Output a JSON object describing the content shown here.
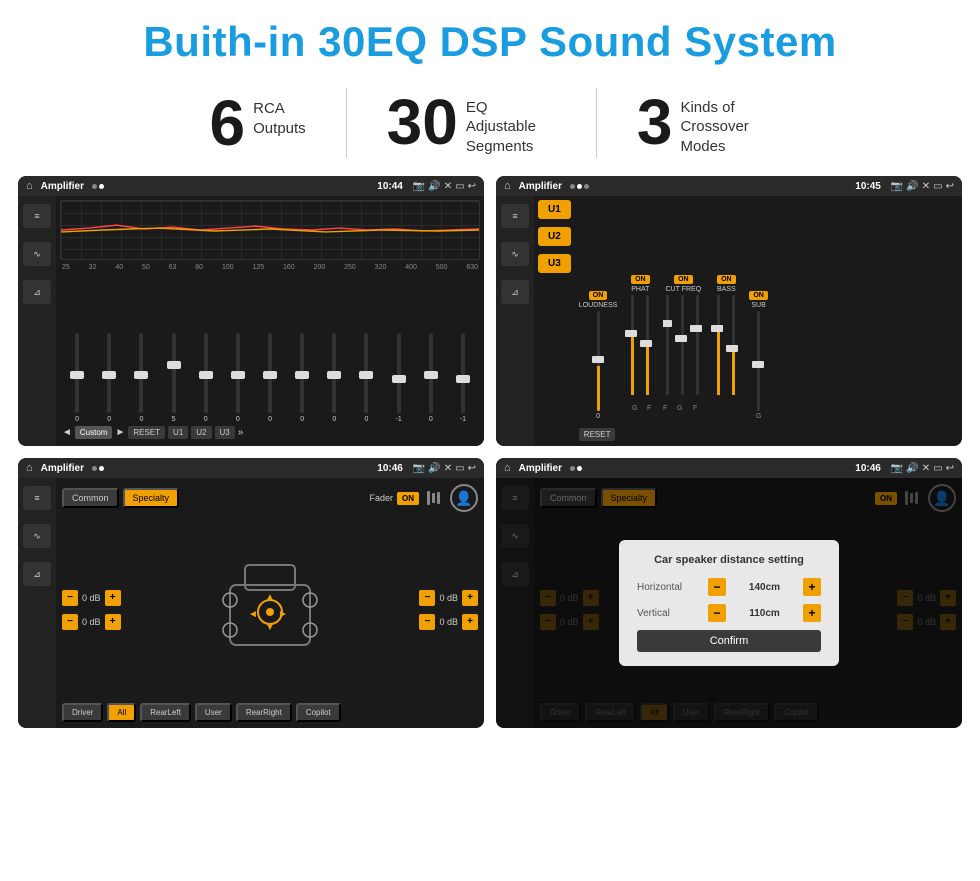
{
  "page": {
    "title": "Buith-in 30EQ DSP Sound System",
    "stats": [
      {
        "number": "6",
        "label": "RCA\nOutputs"
      },
      {
        "number": "30",
        "label": "EQ Adjustable\nSegments"
      },
      {
        "number": "3",
        "label": "Kinds of\nCrossover Modes"
      }
    ]
  },
  "screen1": {
    "appName": "Amplifier",
    "time": "10:44",
    "freqLabels": [
      "25",
      "32",
      "40",
      "50",
      "63",
      "80",
      "100",
      "125",
      "160",
      "200",
      "250",
      "320",
      "400",
      "500",
      "630"
    ],
    "sliderValues": [
      "0",
      "0",
      "0",
      "5",
      "0",
      "0",
      "0",
      "0",
      "0",
      "0",
      "-1",
      "0",
      "-1"
    ],
    "buttons": [
      "◄",
      "Custom",
      "►",
      "RESET",
      "U1",
      "U2",
      "U3"
    ]
  },
  "screen2": {
    "appName": "Amplifier",
    "time": "10:45",
    "uButtons": [
      "U1",
      "U2",
      "U3"
    ],
    "columns": [
      {
        "label": "LOUDNESS",
        "on": true
      },
      {
        "label": "PHAT",
        "on": true
      },
      {
        "label": "CUT FREQ",
        "on": true
      },
      {
        "label": "BASS",
        "on": true
      },
      {
        "label": "SUB",
        "on": true
      }
    ],
    "resetBtn": "RESET"
  },
  "screen3": {
    "appName": "Amplifier",
    "time": "10:46",
    "tabs": [
      "Common",
      "Specialty"
    ],
    "faderLabel": "Fader",
    "onToggle": "ON",
    "dbValues": [
      "0 dB",
      "0 dB",
      "0 dB",
      "0 dB"
    ],
    "bottomBtns": [
      "Driver",
      "RearLeft",
      "All",
      "User",
      "RearRight",
      "Copilot"
    ]
  },
  "screen4": {
    "appName": "Amplifier",
    "time": "10:46",
    "tabs": [
      "Common",
      "Specialty"
    ],
    "onToggle": "ON",
    "dialog": {
      "title": "Car speaker distance setting",
      "horizontal": "140cm",
      "vertical": "110cm",
      "horizontalLabel": "Horizontal",
      "verticalLabel": "Vertical",
      "confirmBtn": "Confirm",
      "dbValues": [
        "0 dB",
        "0 dB"
      ]
    },
    "bottomBtns": [
      "Driver",
      "RearLeft",
      "All",
      "User",
      "RearRight",
      "Copilot"
    ]
  }
}
